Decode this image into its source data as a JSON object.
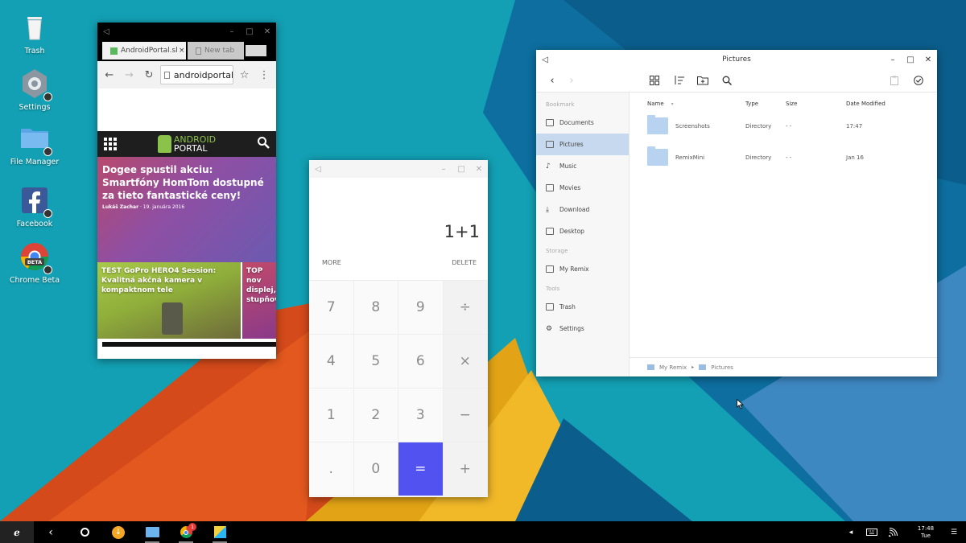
{
  "desktop": {
    "icons": [
      {
        "label": "Trash"
      },
      {
        "label": "Settings"
      },
      {
        "label": "File Manager"
      },
      {
        "label": "Facebook"
      },
      {
        "label": "Chrome Beta",
        "badge": "BETA"
      }
    ]
  },
  "chrome": {
    "tabs": [
      {
        "title": "AndroidPortal.sk",
        "close": "×"
      },
      {
        "title": "New tab",
        "close": "×"
      }
    ],
    "url": "androidportal.sk",
    "site_logo_line1": "ANDROID",
    "site_logo_line2": "PORTAL",
    "main_article": {
      "headline": "Dogee spustil akciu: Smartfóny HomTom dostupné za tieto fantastické ceny!",
      "author": "Lukáš Zachar",
      "date": "19. januára 2016"
    },
    "sub_articles": [
      {
        "headline": "TEST GoPro HERO4 Session: Kvalitná akčná kamera v kompaktnom tele"
      },
      {
        "headline": "TOP nov displej, stupňov"
      }
    ]
  },
  "calculator": {
    "expression": "1+1",
    "more_label": "MORE",
    "delete_label": "DELETE",
    "keys": [
      "7",
      "8",
      "9",
      "÷",
      "4",
      "5",
      "6",
      "×",
      "1",
      "2",
      "3",
      "−",
      ".",
      "0",
      "=",
      "+"
    ]
  },
  "file_manager": {
    "title": "Pictures",
    "sidebar": {
      "sections": [
        {
          "title": "Bookmark",
          "items": [
            "Documents",
            "Pictures",
            "Music",
            "Movies",
            "Download",
            "Desktop"
          ]
        },
        {
          "title": "Storage",
          "items": [
            "My Remix"
          ]
        },
        {
          "title": "Tools",
          "items": [
            "Trash",
            "Settings"
          ]
        }
      ],
      "active_item": "Pictures"
    },
    "columns": {
      "name": "Name",
      "type": "Type",
      "size": "Size",
      "modified": "Date Modified"
    },
    "rows": [
      {
        "name": "Screenshots",
        "type": "Directory",
        "size": "- -",
        "modified": "17:47"
      },
      {
        "name": "RemixMini",
        "type": "Directory",
        "size": "- -",
        "modified": "Jan 16"
      }
    ],
    "breadcrumb": [
      "My Remix",
      "Pictures"
    ]
  },
  "taskbar": {
    "chrome_badge": "1",
    "clock_time": "17:48",
    "clock_day": "Tue"
  },
  "colors": {
    "accent_equals": "#5152f0",
    "selection": "#c7d9ee",
    "folder": "#b8d3ef"
  }
}
